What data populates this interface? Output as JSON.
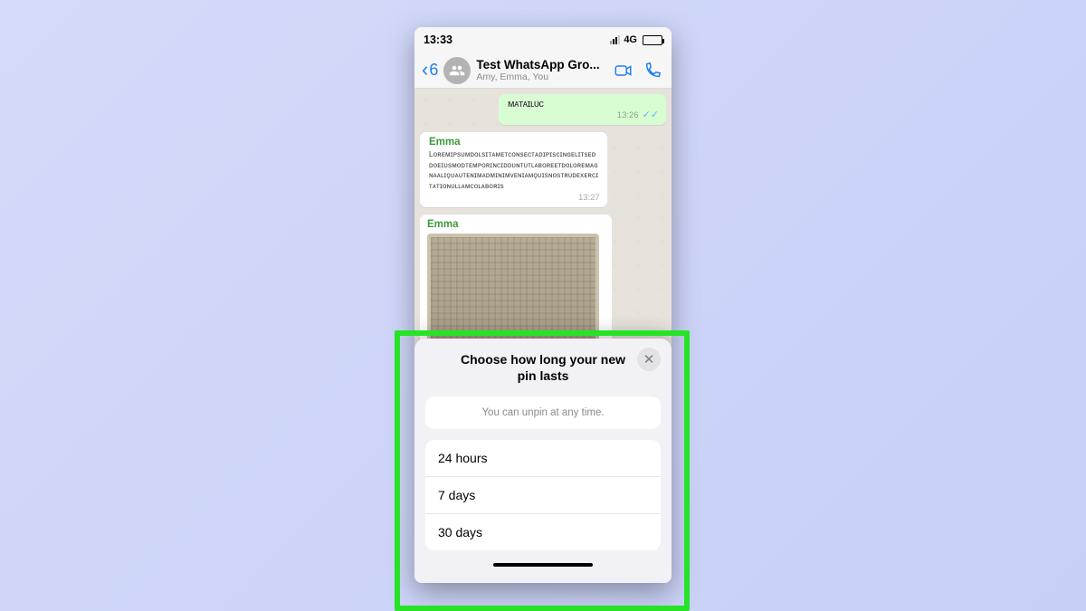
{
  "status": {
    "time": "13:33",
    "network": "4G"
  },
  "nav": {
    "back_count": "6",
    "title": "Test WhatsApp Gro...",
    "subtitle": "Amy, Emma, You"
  },
  "messages": {
    "out1": {
      "time": "13:26"
    },
    "in1": {
      "sender": "Emma",
      "time": "13:27"
    },
    "in2": {
      "sender": "Emma"
    }
  },
  "sheet": {
    "title": "Choose how long your new pin lasts",
    "hint": "You can unpin at any time.",
    "options": [
      "24 hours",
      "7 days",
      "30 days"
    ]
  }
}
